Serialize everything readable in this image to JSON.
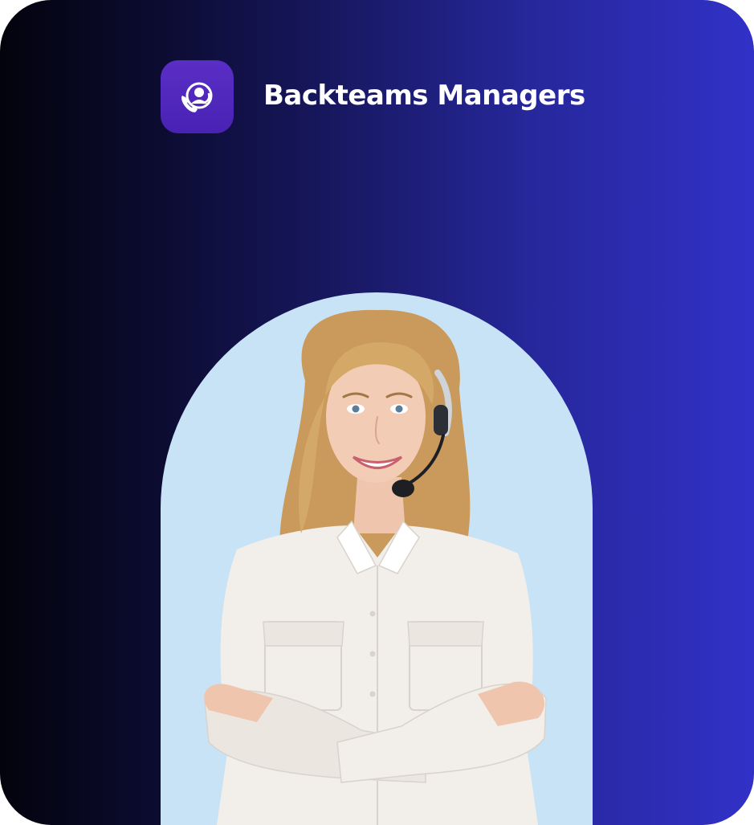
{
  "brand": {
    "name": "Backteams Managers",
    "logo_icon": "support-agent-phone-icon"
  },
  "hero": {
    "photo_subject": "customer-support-agent-portrait"
  },
  "colors": {
    "gradient_start": "#03030d",
    "gradient_end": "#3131c8",
    "logo_tile": "#4f27bb",
    "arch_background": "#c9e3f6",
    "text": "#ffffff"
  }
}
